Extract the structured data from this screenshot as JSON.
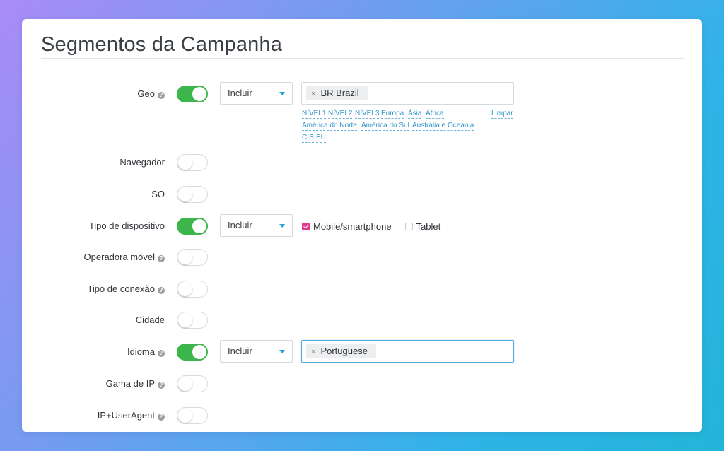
{
  "title": "Segmentos da Campanha",
  "accent_colors": {
    "toggle_on": "#3cb54a",
    "link": "#2d93cc",
    "checkbox": "#e0388f"
  },
  "rows": {
    "geo": {
      "label": "Geo",
      "help": "?",
      "enabled": true,
      "mode": "Incluir",
      "tag": "BR Brazil",
      "tag_remove": "×"
    },
    "navegador": {
      "label": "Navegador",
      "enabled": false
    },
    "so": {
      "label": "SO",
      "enabled": false
    },
    "tipo_dispositivo": {
      "label": "Tipo de dispositivo",
      "enabled": true,
      "mode": "Incluir",
      "options": [
        {
          "label": "Mobile/smartphone",
          "checked": true
        },
        {
          "label": "Tablet",
          "checked": false
        }
      ]
    },
    "operadora": {
      "label": "Operadora móvel",
      "help": "?",
      "enabled": false
    },
    "tipo_conexao": {
      "label": "Tipo de conexão",
      "help": "?",
      "enabled": false
    },
    "cidade": {
      "label": "Cidade",
      "enabled": false
    },
    "idioma": {
      "label": "Idioma",
      "help": "?",
      "enabled": true,
      "mode": "Incluir",
      "tag": "Portuguese",
      "tag_remove": "×"
    },
    "gama_ip": {
      "label": "Gama de IP",
      "help": "?",
      "enabled": false
    },
    "ip_useragent": {
      "label": "IP+UserAgent",
      "help": "?",
      "enabled": false
    }
  },
  "geo_shortcuts": {
    "nivel1": "NÍVEL1",
    "nivel2": "NÍVEL2",
    "nivel3": "NÍVEL3",
    "europa": "Europa",
    "asia": "Ásia",
    "africa": "África",
    "limpar": "Limpar",
    "america_norte": "América do Norte",
    "america_sul": "América do Sul",
    "australia": "Austrália e Oceania",
    "cis": "CIS",
    "eu": "EU"
  }
}
